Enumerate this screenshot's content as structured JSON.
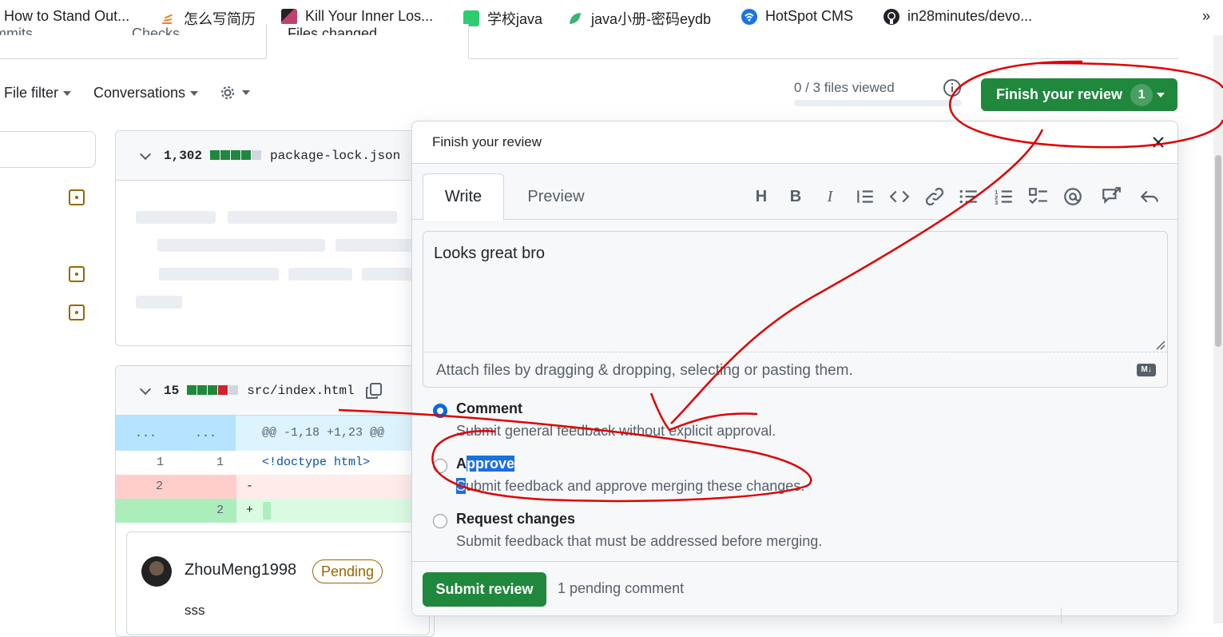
{
  "bookmarks": [
    {
      "label": "How to Stand Out...",
      "icon": "stackoverflow-icon",
      "color": "#f48024"
    },
    {
      "label": "怎么写简历",
      "icon": "stackoverflow-icon",
      "color": "#f48024"
    },
    {
      "label": "Kill Your Inner Los...",
      "icon": "site-icon",
      "color": "#8b1a4a"
    },
    {
      "label": "学校java",
      "icon": "site-icon",
      "color": "#2ecc71"
    },
    {
      "label": "java小册-密码eydb",
      "icon": "leaf-icon",
      "color": "#3cb371"
    },
    {
      "label": "HotSpot CMS",
      "icon": "wifi-icon",
      "color": "#1a73e8"
    },
    {
      "label": "in28minutes/devo...",
      "icon": "github-icon",
      "color": "#1f2328"
    }
  ],
  "bookmarks_more": "»",
  "pr_tabs": [
    {
      "label": "Commits"
    },
    {
      "label": "Checks"
    },
    {
      "label": "Files changed"
    }
  ],
  "toolbar": {
    "file_filter": "File filter",
    "conversations": "Conversations",
    "files_viewed": "0 / 3 files viewed",
    "finish_review": "Finish your review",
    "finish_count": "1"
  },
  "files": [
    {
      "count": "1,302",
      "name": "package-lock.json",
      "bar": [
        "g",
        "g",
        "g",
        "g",
        "gr"
      ]
    },
    {
      "count": "15",
      "name": "src/index.html",
      "bar": [
        "g",
        "g",
        "g",
        "r",
        "gr"
      ]
    }
  ],
  "diff": {
    "hunk_left": "...",
    "hunk_right": "...",
    "hunk_header": "@@ -1,18 +1,23 @@",
    "rows": [
      {
        "old": "1",
        "new": "1",
        "code": "<!doctype html>",
        "kind": "context"
      },
      {
        "old": "2",
        "new": "",
        "code": "-",
        "kind": "del"
      },
      {
        "old": "",
        "new": "2",
        "code": "+",
        "kind": "add"
      }
    ]
  },
  "comment_card": {
    "author": "ZhouMeng1998",
    "badge": "Pending",
    "body": "sss"
  },
  "popover": {
    "title": "Finish your review",
    "tab_write": "Write",
    "tab_preview": "Preview",
    "textarea_value": "Looks great bro",
    "attach_hint": "Attach files by dragging & dropping, selecting or pasting them.",
    "options": [
      {
        "title": "Comment",
        "desc": "Submit general feedback without explicit approval.",
        "checked": true
      },
      {
        "title": "Approve",
        "desc": "Submit feedback and approve merging these changes.",
        "checked": false
      },
      {
        "title": "Request changes",
        "desc": "Submit feedback that must be addressed before merging.",
        "checked": false
      }
    ],
    "submit": "Submit review",
    "pending_text": "1 pending comment"
  },
  "colors": {
    "accent_green": "#1f883d",
    "link_blue": "#0969da",
    "pending_amber": "#9a6700",
    "annotation_red": "#e00000"
  }
}
